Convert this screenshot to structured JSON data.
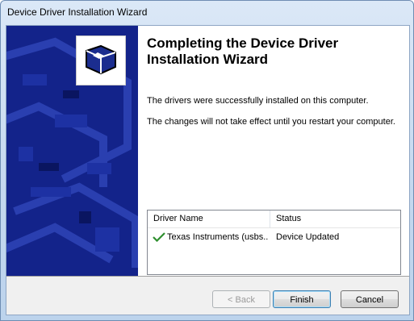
{
  "window": {
    "title": "Device Driver Installation Wizard"
  },
  "wizard": {
    "heading": "Completing the Device Driver Installation Wizard",
    "message1": "The drivers were successfully installed on this computer.",
    "message2": "The changes will not take effect until you restart your computer."
  },
  "table": {
    "columns": [
      "Driver Name",
      "Status"
    ],
    "rows": [
      {
        "name": "Texas Instruments (usbs...",
        "status": "Device Updated",
        "icon": "checkmark-icon"
      }
    ]
  },
  "buttons": {
    "back": "< Back",
    "finish": "Finish",
    "cancel": "Cancel"
  },
  "colors": {
    "sidebar": "#13238a",
    "check": "#2f8f2f"
  }
}
